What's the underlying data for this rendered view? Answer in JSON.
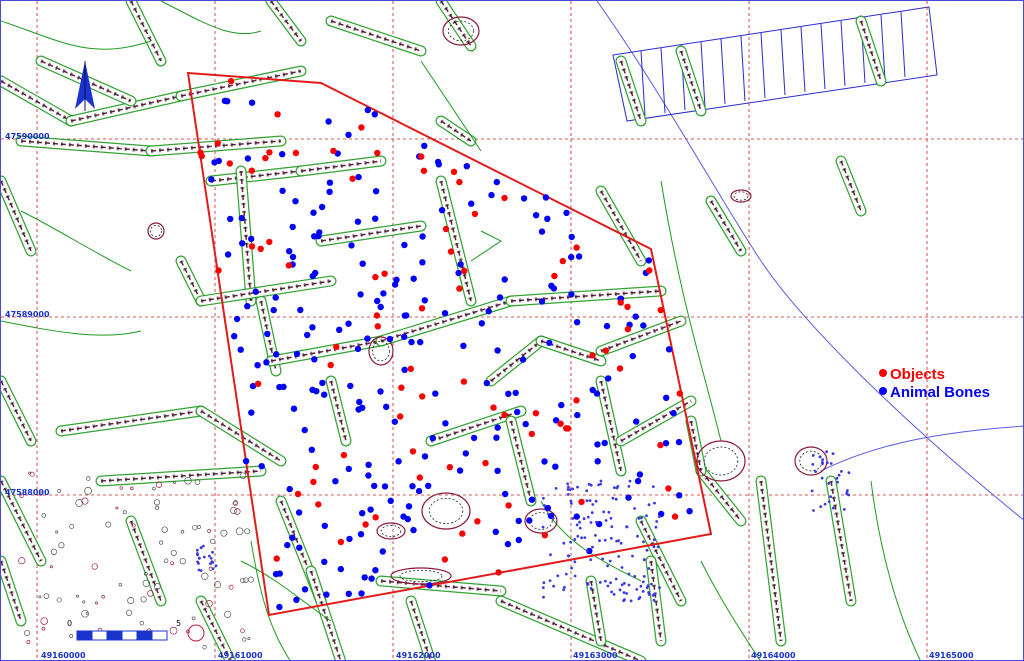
{
  "map": {
    "grid_x_labels": [
      "49160000",
      "49161000",
      "49162000",
      "49163000",
      "49164000",
      "49165000"
    ],
    "grid_y_labels": [
      "47590000",
      "47589000",
      "47588000"
    ],
    "legend": [
      {
        "label": "Objects",
        "color": "#ff0000"
      },
      {
        "label": "Animal Bones",
        "color": "#0000ff"
      }
    ],
    "scale_labels": [
      "0",
      "5"
    ],
    "north_arrow_color": "#1a33cc",
    "colors": {
      "grid": "#cc2222",
      "boundary": "#e21b1b",
      "features": "#1e9a1e",
      "river": "#5a5ae6",
      "objects": "#ff0000",
      "animal_bones": "#0000ff"
    }
  }
}
